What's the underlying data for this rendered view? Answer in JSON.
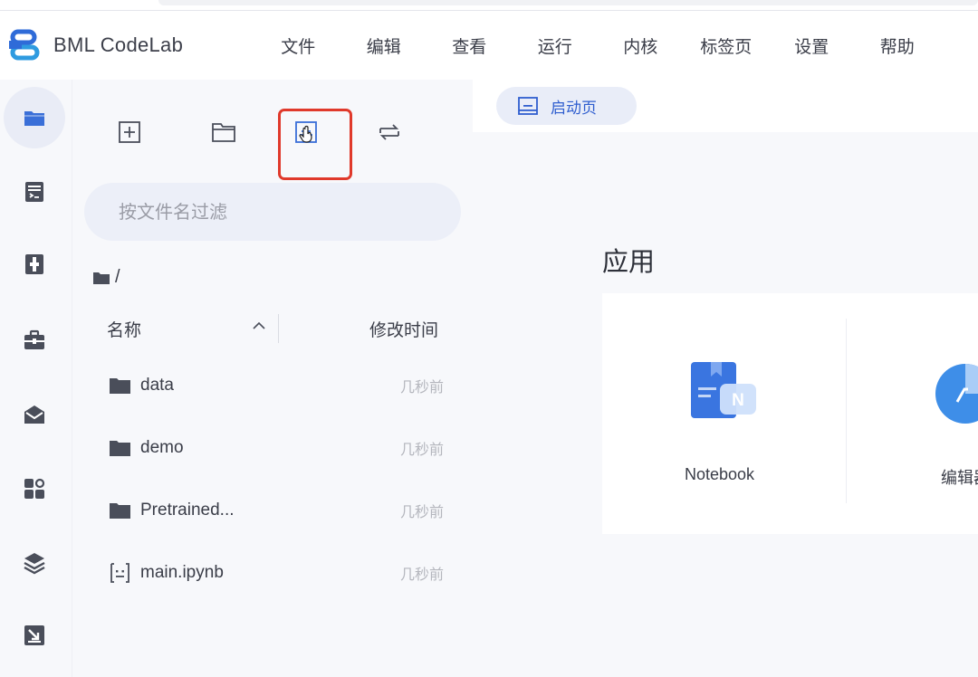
{
  "app": {
    "name": "BML CodeLab"
  },
  "menu": {
    "items": [
      "文件",
      "编辑",
      "查看",
      "运行",
      "内核",
      "标签页",
      "设置",
      "帮助"
    ]
  },
  "activity_bar": {
    "items": [
      {
        "name": "file-browser",
        "icon": "folder-icon",
        "active": true
      },
      {
        "name": "running",
        "icon": "notebook-list-icon"
      },
      {
        "name": "dataset",
        "icon": "dataset-icon"
      },
      {
        "name": "toolbox",
        "icon": "toolbox-icon"
      },
      {
        "name": "mail",
        "icon": "envelope-icon"
      },
      {
        "name": "extensions",
        "icon": "apps-icon"
      },
      {
        "name": "layers",
        "icon": "layers-icon"
      },
      {
        "name": "download",
        "icon": "download-icon"
      }
    ]
  },
  "file_browser": {
    "toolbar": [
      "new-launcher-icon",
      "new-folder-icon",
      "upload-icon",
      "refresh-icon"
    ],
    "filter_placeholder": "按文件名过滤",
    "breadcrumb": "/",
    "columns": {
      "name": "名称",
      "modified": "修改时间"
    },
    "files": [
      {
        "name": "data",
        "type": "folder",
        "modified": "几秒前"
      },
      {
        "name": "demo",
        "type": "folder",
        "modified": "几秒前"
      },
      {
        "name": "Pretrained...",
        "type": "folder",
        "modified": "几秒前"
      },
      {
        "name": "main.ipynb",
        "type": "notebook",
        "modified": "几秒前"
      }
    ]
  },
  "tabs": [
    {
      "label": "启动页",
      "active": true
    }
  ],
  "launcher": {
    "section_title": "应用",
    "cards": [
      {
        "label": "Notebook"
      },
      {
        "label": "编辑器"
      }
    ]
  },
  "colors": {
    "accent": "#2f5ecf",
    "highlight": "#e0392b",
    "icon_blue": "#3a6fd8"
  }
}
